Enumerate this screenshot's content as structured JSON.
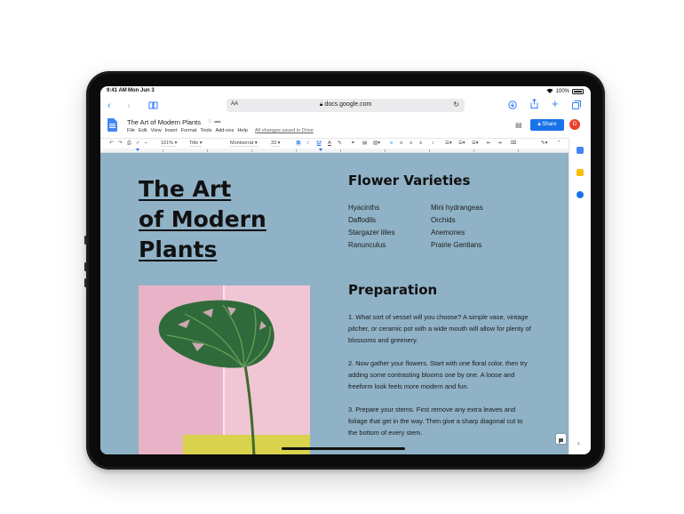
{
  "status_bar": {
    "time": "9:41 AM",
    "date": "Mon Jun 3",
    "battery": "100%"
  },
  "safari": {
    "text_size_label": "AA",
    "url": "docs.google.com"
  },
  "docs": {
    "title": "The Art of Modern Plants",
    "menu": [
      "File",
      "Edit",
      "View",
      "Insert",
      "Format",
      "Tools",
      "Add-ons",
      "Help"
    ],
    "saved_status": "All changes saved in Drive",
    "share_label": "Share",
    "avatar_initial": "D"
  },
  "format_toolbar": {
    "zoom": "161%",
    "style": "Title",
    "font": "Montserrat",
    "font_size": "33",
    "bold": "B",
    "italic": "I",
    "underline": "U",
    "text_color": "A"
  },
  "document": {
    "title_lines": [
      "The Art",
      "of Modern",
      "Plants"
    ],
    "varieties_heading": "Flower Varieties",
    "varieties": [
      "Hyacinths",
      "Mini hydrangeas",
      "Daffodils",
      "Orchids",
      "Stargazer lilies",
      "Anemones",
      "Ranunculus",
      "Prairie Gentians"
    ],
    "prep_heading": "Preparation",
    "prep_paragraphs": [
      "1. What sort of vessel will you choose? A simple vase, vintage pitcher, or ceramic pot with a wide mouth will allow for plenty of blossoms and greenery.",
      "2. Now gather your flowers. Start with one floral color, then try adding some contrasting blooms one by one. A loose and freeform look feels more modern and fun.",
      "3. Prepare your stems. First remove any extra leaves and foliage that get in the way. Then give a sharp diagonal cut to the bottom of every stem."
    ]
  },
  "colors": {
    "page_background": "#8fb2c6",
    "share_button": "#1a73e8",
    "safari_accent": "#2f7cf6",
    "photo_pink": "#e8b3c6",
    "monstera_green": "#2f6b3a"
  }
}
